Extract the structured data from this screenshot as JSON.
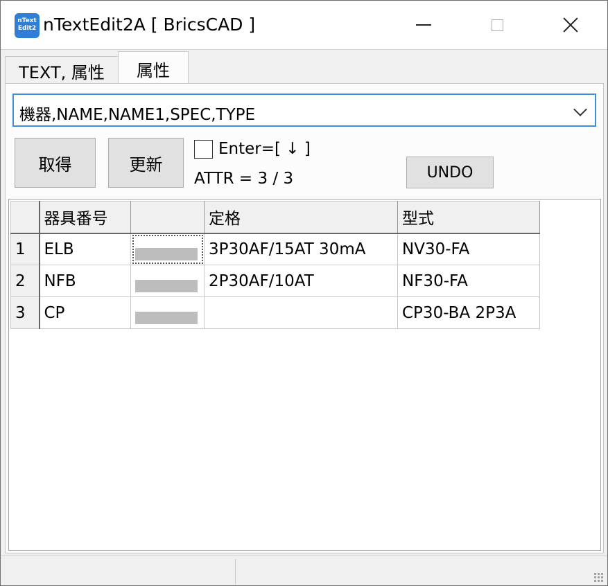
{
  "window": {
    "title": "nTextEdit2A [ BricsCAD ]",
    "icon_label": "nText Edit2"
  },
  "tabs": [
    {
      "label": "TEXT, 属性"
    },
    {
      "label": "属性"
    }
  ],
  "combo": {
    "value": "機器,NAME,NAME1,SPEC,TYPE"
  },
  "buttons": {
    "get": "取得",
    "update": "更新",
    "undo": "UNDO"
  },
  "enter_option": {
    "label": "Enter=[ ↓ ]",
    "checked": false
  },
  "attr_count": "ATTR = 3 / 3",
  "grid": {
    "columns": [
      "器具番号",
      "",
      "定格",
      "型式"
    ],
    "rows": [
      {
        "num": "1",
        "cells": [
          "ELB",
          "",
          "3P30AF/15AT 30mA",
          "NV30-FA"
        ]
      },
      {
        "num": "2",
        "cells": [
          "NFB",
          "",
          "2P30AF/10AT",
          "NF30-FA"
        ]
      },
      {
        "num": "3",
        "cells": [
          "CP",
          "",
          "",
          "CP30-BA 2P3A"
        ]
      }
    ]
  },
  "statusbar": {
    "left": "",
    "right": ""
  }
}
